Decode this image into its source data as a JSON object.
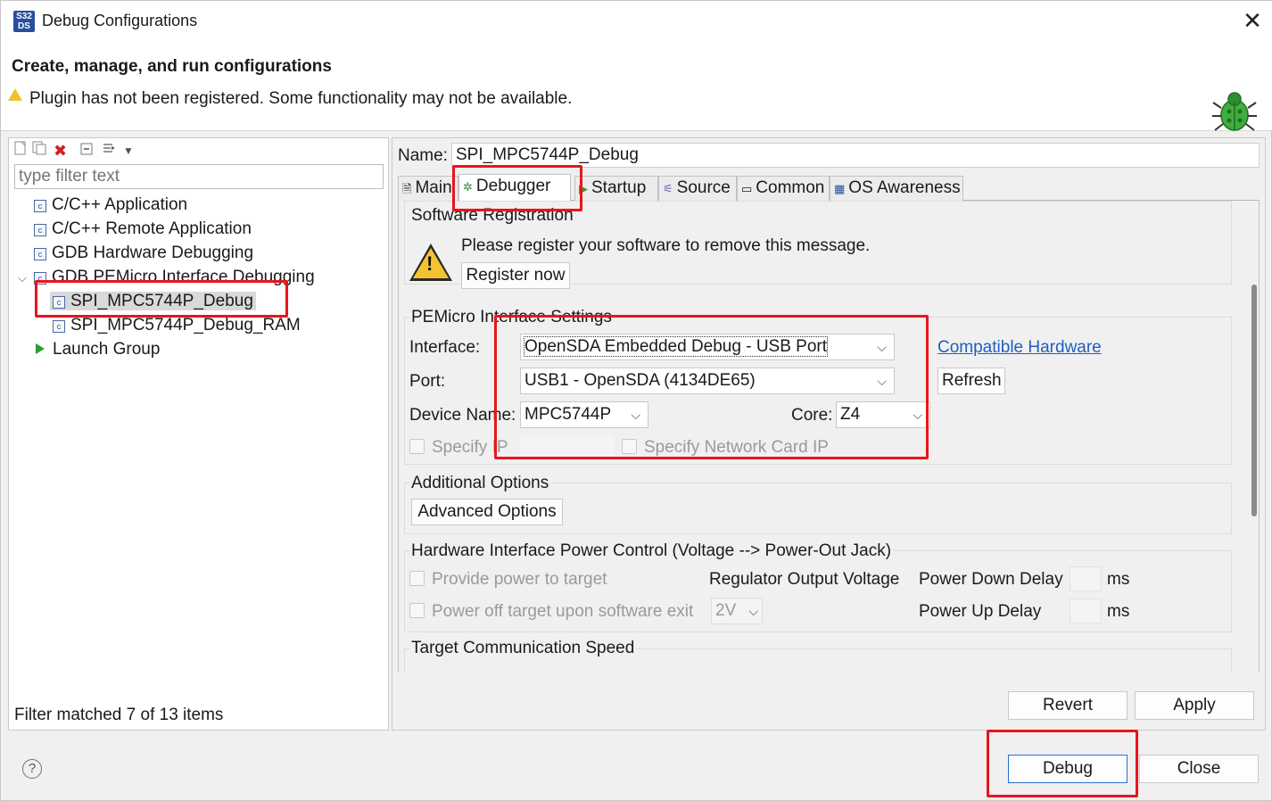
{
  "window": {
    "title": "Debug Configurations",
    "app_icon_text": "S32 DS",
    "close_glyph": "✕"
  },
  "header": {
    "title": "Create, manage, and run configurations",
    "warning": "Plugin has not been registered. Some functionality may not be available."
  },
  "left": {
    "filter_placeholder": "type filter text",
    "tree": [
      {
        "label": "C/C++ Application",
        "icon": "c-config-icon"
      },
      {
        "label": "C/C++ Remote Application",
        "icon": "c-config-icon"
      },
      {
        "label": "GDB Hardware Debugging",
        "icon": "c-config-icon"
      },
      {
        "label": "GDB PEMicro Interface Debugging",
        "icon": "c-config-icon",
        "expanded": true
      },
      {
        "label": "SPI_MPC5744P_Debug",
        "icon": "c-config-icon",
        "selected": true
      },
      {
        "label": "SPI_MPC5744P_Debug_RAM",
        "icon": "c-config-icon"
      },
      {
        "label": "Launch Group",
        "icon": "launch-group-icon"
      }
    ],
    "expander_glyph": "⌵",
    "status": "Filter matched 7 of 13 items"
  },
  "right": {
    "name_label": "Name:",
    "name_value": "SPI_MPC5744P_Debug",
    "tabs": [
      "Main",
      "Debugger",
      "Startup",
      "Source",
      "Common",
      "OS Awareness"
    ],
    "active_tab": "Debugger",
    "software_registration": {
      "title": "Software Registration",
      "message": "Please register your software to remove this message.",
      "register_button": "Register now"
    },
    "pemicro": {
      "title": "PEMicro Interface Settings",
      "interface_label": "Interface:",
      "interface_value": "OpenSDA Embedded Debug - USB Port",
      "compatible_link": "Compatible Hardware",
      "port_label": "Port:",
      "port_value": "USB1 - OpenSDA (4134DE65)",
      "refresh_button": "Refresh",
      "device_label": "Device Name:",
      "device_value": "MPC5744P",
      "core_label": "Core:",
      "core_value": "Z4",
      "specify_ip": "Specify IP",
      "specify_nic": "Specify Network Card IP"
    },
    "additional": {
      "title": "Additional Options",
      "button": "Advanced Options"
    },
    "power": {
      "title": "Hardware Interface Power Control (Voltage --> Power-Out Jack)",
      "provide_power": "Provide power to target",
      "regulator_label": "Regulator Output Voltage",
      "power_down_label": "Power Down Delay",
      "ms1": "ms",
      "power_off": "Power off target upon software exit",
      "voltage_value": "2V",
      "power_up_label": "Power Up Delay",
      "ms2": "ms"
    },
    "target_speed": {
      "title": "Target Communication Speed"
    },
    "revert_button": "Revert",
    "apply_button": "Apply"
  },
  "footer": {
    "help_glyph": "?",
    "debug_button": "Debug",
    "close_button": "Close"
  },
  "colors": {
    "highlight": "#e8151b",
    "link": "#1f5fbf"
  }
}
